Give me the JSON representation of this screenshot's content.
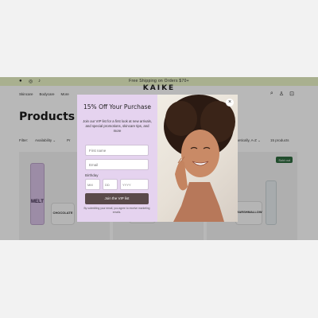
{
  "announcement": {
    "text": "Free Shipping on Orders $70+",
    "social_icons": [
      "facebook-icon",
      "instagram-icon",
      "tiktok-icon"
    ]
  },
  "header": {
    "logo": "KAIKE",
    "nav": [
      "Skincare",
      "Bodycare",
      "More"
    ],
    "icons": [
      "search-icon",
      "account-icon",
      "cart-icon"
    ]
  },
  "page": {
    "title": "Products",
    "filter_label": "Filter:",
    "filter_availability": "Availability ⌄",
    "filter_price": "Pr",
    "sort": "Alphabetically, A-Z ⌄",
    "product_count": "15 products"
  },
  "products": [
    {
      "name": "MELT",
      "badge": ""
    },
    {
      "name": "CHOCOLATE",
      "badge": ""
    },
    {
      "name": "",
      "badge": ""
    },
    {
      "name": "MARSHMALLOW",
      "badge": "Sold out"
    }
  ],
  "modal": {
    "title": "15% Off Your Purchase",
    "description": "Join our VIP list for a first look at new arrivals, and special promotions, skincare tips, and more",
    "first_name_placeholder": "First name",
    "email_placeholder": "Email",
    "birthday_label": "Birthday",
    "mm_placeholder": "MM",
    "dd_placeholder": "DD",
    "yyyy_placeholder": "YYYY",
    "button_label": "Join the VIP list",
    "fine_print": "By submitting your email, you agree to receive marketing emails.",
    "close_label": "×"
  },
  "colors": {
    "announcement_bg": "#eaf4c7",
    "modal_bg": "#e5d3ef",
    "button_bg": "#5a4a4a",
    "sold_out_badge": "#2f6b3f"
  }
}
